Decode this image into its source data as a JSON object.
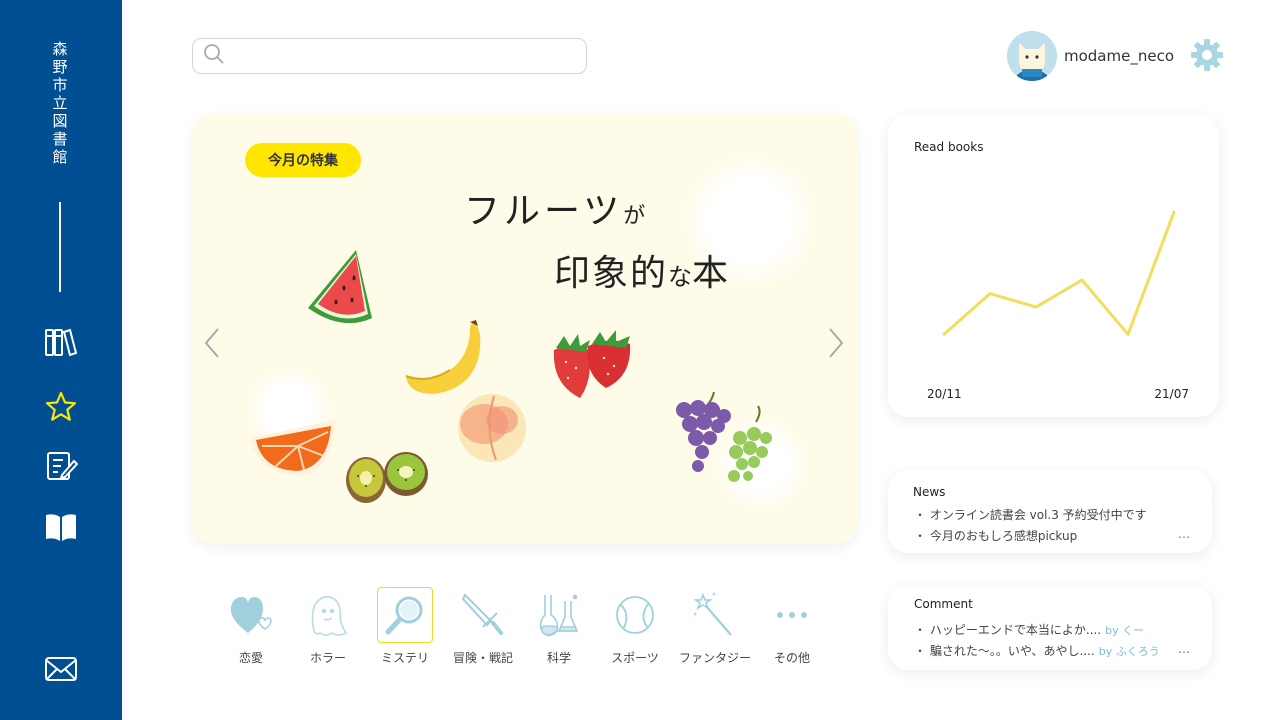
{
  "sidebar": {
    "brand": "森野市立図書館",
    "nav": [
      "bookshelf-icon",
      "star-icon",
      "note-edit-icon",
      "open-book-icon",
      "mail-icon"
    ],
    "accent_color": "#004f92",
    "active_color": "#ffe600"
  },
  "search": {
    "placeholder": ""
  },
  "user": {
    "name": "modame_neco"
  },
  "feature": {
    "badge": "今月の特集",
    "title_main": "フルーツ",
    "title_particle": "が",
    "title_line2_a": "印象的",
    "title_line2_particle": "な",
    "title_line2_b": "本",
    "background": "#fffbe9"
  },
  "categories": [
    {
      "label": "恋愛",
      "icon": "heart-icon"
    },
    {
      "label": "ホラー",
      "icon": "ghost-icon"
    },
    {
      "label": "ミステリ",
      "icon": "magnifier-icon",
      "selected": true
    },
    {
      "label": "冒険・戦記",
      "icon": "sword-icon"
    },
    {
      "label": "科学",
      "icon": "flask-icon"
    },
    {
      "label": "スポーツ",
      "icon": "ball-icon"
    },
    {
      "label": "ファンタジー",
      "icon": "magic-wand-icon"
    },
    {
      "label": "その他",
      "icon": "dots-icon"
    }
  ],
  "read_books": {
    "title": "Read books",
    "x_start": "20/11",
    "x_end": "21/07"
  },
  "chart_data": {
    "type": "line",
    "title": "Read books",
    "x_start_label": "20/11",
    "x_end_label": "21/07",
    "values": [
      3,
      6,
      5,
      7,
      3,
      12
    ],
    "ylim": [
      0,
      14
    ],
    "color": "#f2de5a",
    "grid": false
  },
  "news": {
    "title": "News",
    "items": [
      "オンライン読書会 vol.3 予約受付中です",
      "今月のおもしろ感想pickup"
    ],
    "more": "…"
  },
  "comment": {
    "title": "Comment",
    "items": [
      {
        "text": "ハッピーエンドで本当によか....",
        "by": "by くー"
      },
      {
        "text": "騙された〜。。いや、あやし....",
        "by": "by ふくろう"
      }
    ],
    "more": "…"
  }
}
